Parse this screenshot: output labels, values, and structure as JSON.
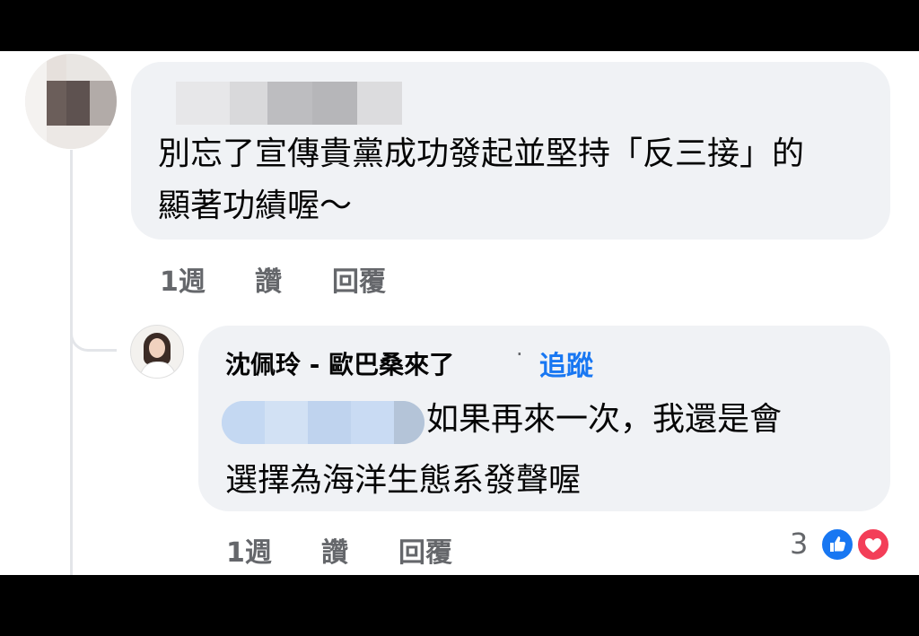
{
  "comment1": {
    "text": "別忘了宣傳貴黨成功發起並堅持「反三接」的顯著功績喔～",
    "time": "1週",
    "like_label": "讚",
    "reply_label": "回覆"
  },
  "reply1": {
    "author": "沈佩玲 - 歐巴桑來了",
    "separator": "·",
    "follow_label": "追蹤",
    "text_line1": "如果再來一次，我還是會",
    "text_line2": "選擇為海洋生態系發聲喔",
    "time": "1週",
    "like_label": "讚",
    "reply_label": "回覆",
    "reaction_count": "3",
    "reaction_icons": [
      "like-icon",
      "love-icon"
    ]
  },
  "colors": {
    "bubble": "#f0f2f5",
    "text": "#050505",
    "secondary": "#65676b",
    "link": "#1877f2",
    "love": "#f33e58"
  }
}
